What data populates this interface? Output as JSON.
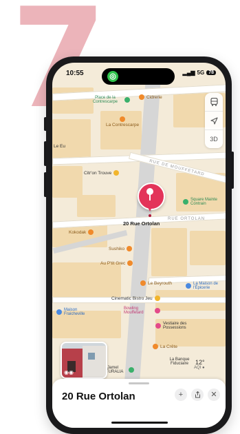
{
  "step_number": "7",
  "status_bar": {
    "time": "10:55",
    "signal": "5G",
    "battery": "78"
  },
  "map_controls": {
    "view_3d_label": "3D"
  },
  "pois": [
    {
      "id": "place-contrescarpe",
      "label": "Place de la Contrescarpe",
      "color": "green"
    },
    {
      "id": "cidrerie",
      "label": "Cidrerie",
      "color": "orange"
    },
    {
      "id": "la-contrescarpe",
      "label": "La Contrescarpe",
      "color": "orange"
    },
    {
      "id": "shop-left",
      "label": "Le Eu",
      "color": "none"
    },
    {
      "id": "citron",
      "label": "Citr'on Trouve",
      "color": "yellow"
    },
    {
      "id": "square-mainte",
      "label": "Square Mainte Contrain",
      "color": "green"
    },
    {
      "id": "kokodak",
      "label": "Kokodak",
      "color": "orange"
    },
    {
      "id": "sushiko",
      "label": "Sushiko",
      "color": "orange"
    },
    {
      "id": "au-ptit-grec",
      "label": "Au P'tit Grec",
      "color": "orange"
    },
    {
      "id": "le-beyrouth",
      "label": "Le Beyrouth",
      "color": "orange"
    },
    {
      "id": "cinematic",
      "label": "Cinematic Bistro Jeu",
      "color": "yellow"
    },
    {
      "id": "la-maison",
      "label": "La Maison de l'Épicerie",
      "color": "blue"
    },
    {
      "id": "maison-fraiche",
      "label": "Maison Fraicheville",
      "color": "blue"
    },
    {
      "id": "bowling",
      "label": "Bowling Mouffetard",
      "color": "pink"
    },
    {
      "id": "vestiaire",
      "label": "Vestiaire des Possessions",
      "color": "pink"
    },
    {
      "id": "la-crete",
      "label": "La Crête",
      "color": "orange"
    },
    {
      "id": "la-banque",
      "label": "La Banque Fiduciaire",
      "color": "none"
    },
    {
      "id": "jamel",
      "label": "Jamel ZITURALIA",
      "color": "green"
    }
  ],
  "streets": {
    "rue_mouffetard": "RUE DE MOUFFETARD",
    "rue_ortolan": "RUE ORTOLAN"
  },
  "pin": {
    "label": "20 Rue Ortolan"
  },
  "weather": {
    "temperature": "12°",
    "aqi": "AQI ●"
  },
  "sheet": {
    "title": "20 Rue Ortolan"
  },
  "colors": {
    "pin": "#e3345a",
    "accent_step": "#e9a8ae"
  }
}
